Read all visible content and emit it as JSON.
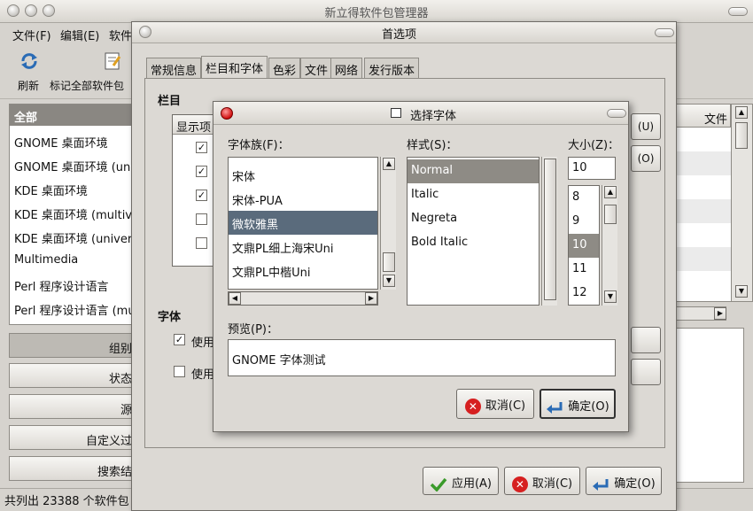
{
  "main": {
    "title": "新立得软件包管理器",
    "menu": [
      "文件(F)",
      "编辑(E)",
      "软件"
    ],
    "toolbar": {
      "reload": "刷新",
      "mark_all": "标记全部软件包"
    },
    "categories_header": "全部",
    "categories": [
      "GNOME 桌面环境",
      "GNOME 桌面环境 (un",
      "KDE 桌面环境",
      "KDE 桌面环境 (multive",
      "KDE 桌面环境 (univers",
      "Multimedia",
      "Perl 程序设计语言",
      "Perl 程序设计语言 (mu"
    ],
    "filter_buttons": [
      "组别",
      "状态",
      "源",
      "自定义过",
      "搜索结"
    ],
    "status": "共列出 23388 个软件包",
    "right_col_header": "文件"
  },
  "prefs": {
    "title": "首选项",
    "tabs": [
      "常规信息",
      "栏目和字体",
      "色彩",
      "文件",
      "网络",
      "发行版本"
    ],
    "columns_label": "栏目",
    "column_header": "显示项",
    "up_btn": "(U)",
    "down_btn": "(O)",
    "font_label": "字体",
    "use_label_1": "使用",
    "use_label_2": "使用",
    "apply": "应用(A)",
    "cancel": "取消(C)",
    "ok": "确定(O)"
  },
  "font_chooser": {
    "title": "选择字体",
    "family_label": "字体族(F)：",
    "style_label": "样式(S)：",
    "size_label": "大小(Z)：",
    "families": [
      "宋体",
      "宋体-PUA",
      "微软雅黑",
      "文鼎PL细上海宋Uni",
      "文鼎PL中楷Uni"
    ],
    "selected_family": "微软雅黑",
    "styles": [
      "Normal",
      "Italic",
      "Negreta",
      "Bold Italic"
    ],
    "selected_style": "Normal",
    "size_value": "10",
    "sizes": [
      "8",
      "9",
      "10",
      "11",
      "12"
    ],
    "selected_size": "10",
    "preview_label": "预览(P)：",
    "preview_text": "GNOME 字体测试",
    "cancel": "取消(C)",
    "ok": "确定(O)"
  }
}
